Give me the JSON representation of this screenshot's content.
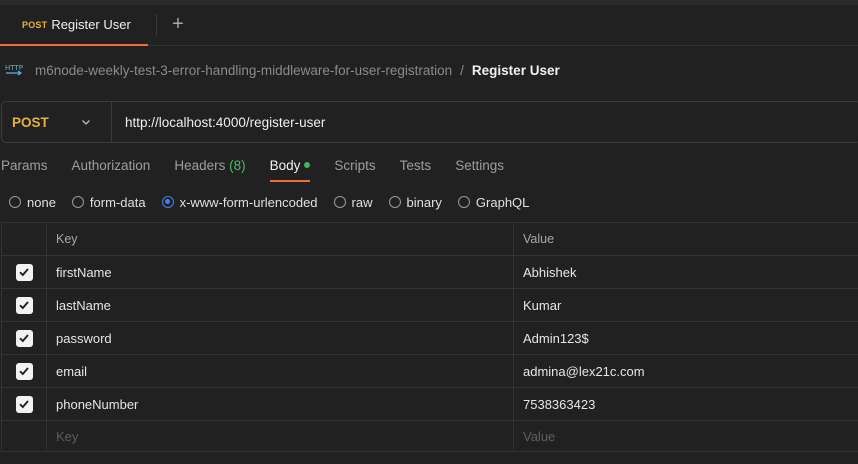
{
  "tabbar": {
    "active_tab": {
      "method": "POST",
      "name": "Register User"
    },
    "new_tab_symbol": "+",
    "accent": "#f26b3a"
  },
  "breadcrumb": {
    "icon": "http-icon",
    "collection": "m6node-weekly-test-3-error-handling-middleware-for-user-registration",
    "separator": "/",
    "current": "Register User"
  },
  "request": {
    "method": "POST",
    "method_color": "#e3b341",
    "url": "http://localhost:4000/register-user"
  },
  "request_tabs": {
    "params": "Params",
    "authorization": "Authorization",
    "headers": "Headers",
    "headers_count": "(8)",
    "body": "Body",
    "scripts": "Scripts",
    "tests": "Tests",
    "settings": "Settings",
    "active": "Body"
  },
  "body_types": {
    "none": "none",
    "form_data": "form-data",
    "urlencoded": "x-www-form-urlencoded",
    "raw": "raw",
    "binary": "binary",
    "graphql": "GraphQL",
    "selected": "x-www-form-urlencoded"
  },
  "table": {
    "headers": {
      "key": "Key",
      "value": "Value"
    },
    "rows": [
      {
        "key": "firstName",
        "value": "Abhishek",
        "checked": true
      },
      {
        "key": "lastName",
        "value": "Kumar",
        "checked": true
      },
      {
        "key": "password",
        "value": "Admin123$",
        "checked": true
      },
      {
        "key": "email",
        "value": "admina@lex21c.com",
        "checked": true
      },
      {
        "key": "phoneNumber",
        "value": "7538363423",
        "checked": true
      }
    ],
    "placeholder": {
      "key": "Key",
      "value": "Value"
    }
  }
}
